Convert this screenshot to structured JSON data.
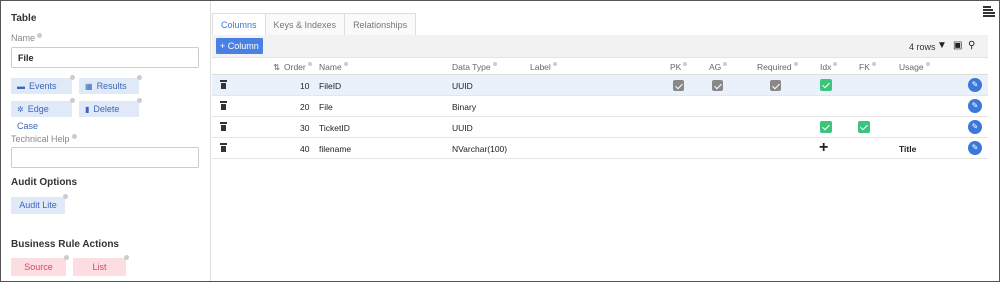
{
  "left": {
    "table_heading": "Table",
    "name_label": "Name",
    "name_value": "File",
    "buttons": {
      "events": "Events",
      "results": "Results",
      "edge_case": "Edge Case",
      "delete": "Delete"
    },
    "technical_help_label": "Technical Help",
    "technical_help_value": "",
    "audit_heading": "Audit Options",
    "audit_lite": "Audit Lite",
    "business_heading": "Business Rule Actions",
    "source": "Source",
    "list": "List"
  },
  "tabs": [
    "Columns",
    "Keys & Indexes",
    "Relationships"
  ],
  "toolbar": {
    "add_column": "+ Column",
    "row_count": "4 rows"
  },
  "columns": [
    "Order",
    "Name",
    "Data Type",
    "Label",
    "PK",
    "AG",
    "Required",
    "Idx",
    "FK",
    "Usage"
  ],
  "rows": [
    {
      "order": "10",
      "name": "FileID",
      "type": "UUID",
      "label": "",
      "pk": true,
      "ag": true,
      "required": true,
      "idx": "check",
      "fk": false,
      "usage": ""
    },
    {
      "order": "20",
      "name": "File",
      "type": "Binary",
      "label": "",
      "pk": false,
      "ag": false,
      "required": false,
      "idx": "none",
      "fk": false,
      "usage": ""
    },
    {
      "order": "30",
      "name": "TicketID",
      "type": "UUID",
      "label": "",
      "pk": false,
      "ag": false,
      "required": false,
      "idx": "check",
      "fk": true,
      "usage": ""
    },
    {
      "order": "40",
      "name": "filename",
      "type": "NVarchar(100)",
      "label": "",
      "pk": false,
      "ag": false,
      "required": false,
      "idx": "plus",
      "fk": false,
      "usage": "Title"
    }
  ],
  "colors": {
    "accent": "#3b78d8",
    "check_green": "#3cc47c",
    "check_grey": "#888888",
    "pink_bg": "#fbdde2",
    "pink_text": "#d7485f"
  }
}
